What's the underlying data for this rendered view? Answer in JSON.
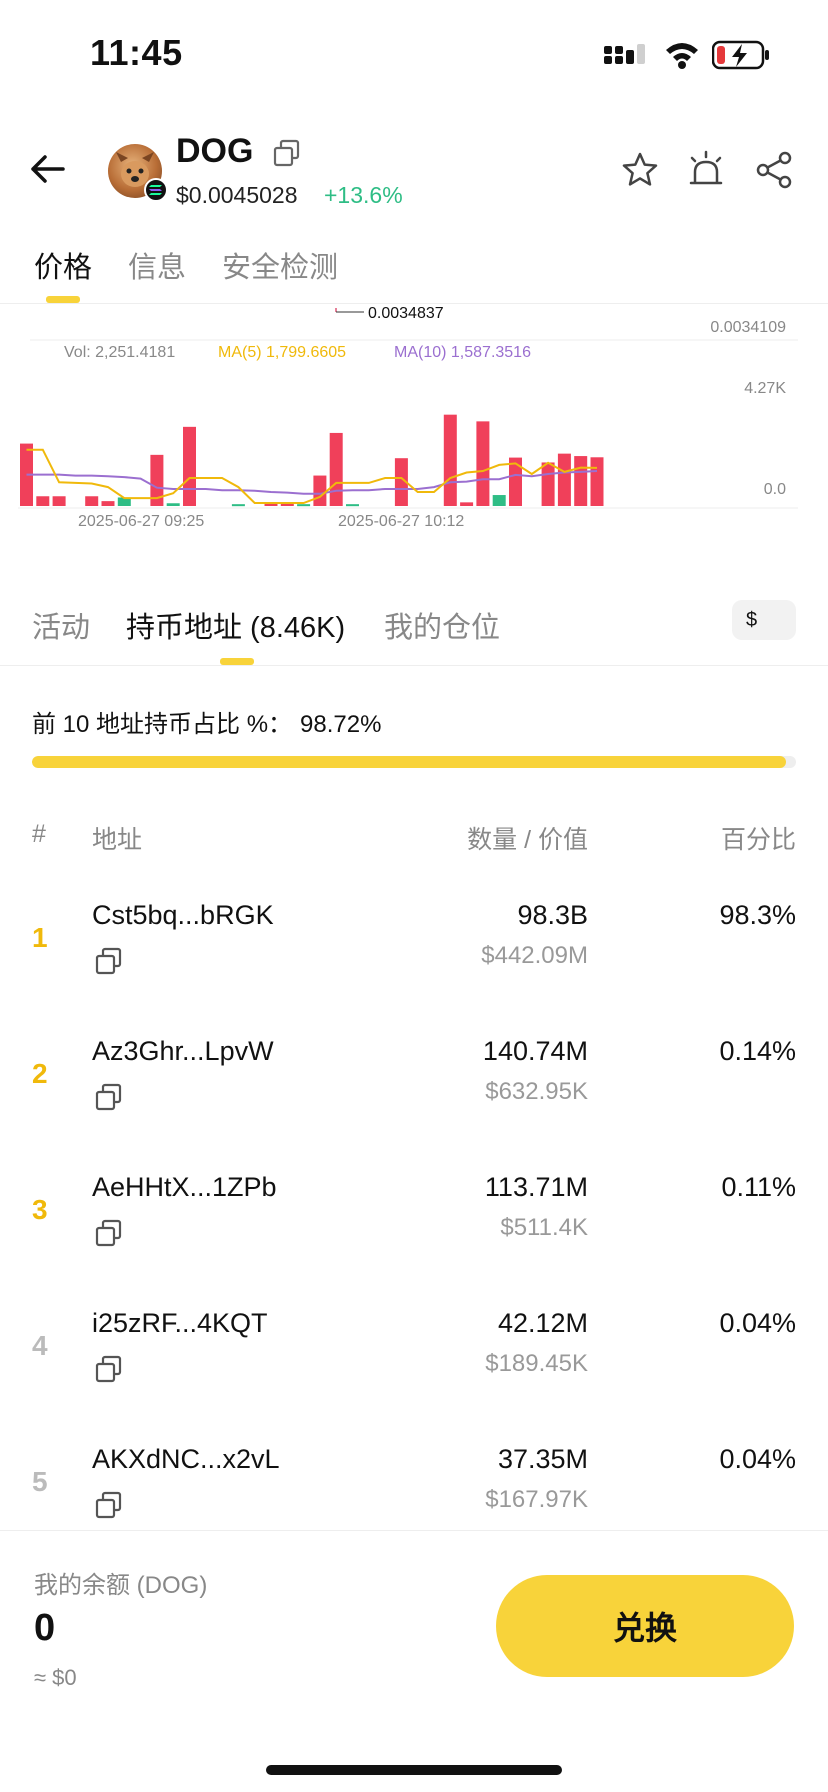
{
  "status_bar": {
    "time": "11:45"
  },
  "header": {
    "token_name": "DOG",
    "price": "$0.0045028",
    "change": "+13.6%",
    "colors": {
      "positive": "#2ebd85",
      "accent": "#f8d33a"
    }
  },
  "top_tabs": [
    {
      "label": "价格",
      "active": true
    },
    {
      "label": "信息",
      "active": false
    },
    {
      "label": "安全检测",
      "active": false
    }
  ],
  "chart_data": {
    "type": "bar",
    "price_marker_label": "0.0034837",
    "right_price_label": "0.0034109",
    "legend": {
      "vol": "Vol: 2,251.4181",
      "ma5": "MA(5) 1,799.6605",
      "ma10": "MA(10) 1,587.3516"
    },
    "y_ticks": [
      "4.27K",
      "0.0"
    ],
    "x_ticks": [
      "2025-06-27 09:25",
      "2025-06-27 10:12"
    ],
    "ylim": [
      0,
      4270
    ],
    "series": [
      {
        "name": "Vol",
        "color_up": "#f0405a",
        "color_down": "#2ebd85",
        "values": [
          2050,
          320,
          320,
          0,
          320,
          160,
          280,
          0,
          1680,
          90,
          2600,
          0,
          0,
          60,
          0,
          70,
          70,
          60,
          1000,
          2400,
          60,
          0,
          0,
          1570,
          0,
          0,
          3000,
          120,
          2780,
          360,
          1590,
          0,
          1430,
          1720,
          1640,
          1600
        ],
        "direction": [
          "up",
          "up",
          "up",
          "up",
          "up",
          "up",
          "down",
          "up",
          "up",
          "down",
          "up",
          "up",
          "up",
          "down",
          "up",
          "up",
          "up",
          "down",
          "up",
          "up",
          "down",
          "up",
          "up",
          "up",
          "up",
          "up",
          "up",
          "up",
          "up",
          "down",
          "up",
          "up",
          "up",
          "up",
          "up",
          "up"
        ]
      },
      {
        "name": "MA(5)",
        "color": "#f0b90b",
        "values": [
          1850,
          1850,
          780,
          760,
          740,
          620,
          260,
          260,
          260,
          420,
          920,
          920,
          920,
          620,
          100,
          100,
          100,
          100,
          300,
          760,
          760,
          760,
          920,
          920,
          460,
          460,
          920,
          1100,
          1150,
          1350,
          1400,
          1050,
          1420,
          1120,
          1260,
          1250
        ]
      },
      {
        "name": "MA(10)",
        "color": "#9b6fd0",
        "values": [
          1030,
          1030,
          1030,
          1000,
          1000,
          980,
          950,
          900,
          600,
          560,
          560,
          560,
          520,
          520,
          500,
          460,
          440,
          400,
          400,
          500,
          520,
          520,
          560,
          560,
          560,
          620,
          780,
          800,
          880,
          880,
          1020,
          980,
          1050,
          1100,
          1120,
          1150
        ]
      }
    ]
  },
  "section_tabs": [
    {
      "label": "活动",
      "active": false
    },
    {
      "label": "持币地址 (8.46K)",
      "active": true
    },
    {
      "label": "我的仓位",
      "active": false
    }
  ],
  "currency_toggle": "$",
  "top10": {
    "label": "前 10 地址持币占比 %：",
    "value": "98.72%",
    "fraction": 0.9872
  },
  "table": {
    "headers": {
      "num": "#",
      "address": "地址",
      "qty_value": "数量 / 价值",
      "percent": "百分比"
    },
    "rows": [
      {
        "rank": "1",
        "address": "Cst5bq...bRGK",
        "qty": "98.3B",
        "value": "$442.09M",
        "percent": "98.3%",
        "rank_color": "#f0b90b"
      },
      {
        "rank": "2",
        "address": "Az3Ghr...LpvW",
        "qty": "140.74M",
        "value": "$632.95K",
        "percent": "0.14%",
        "rank_color": "#f0b90b"
      },
      {
        "rank": "3",
        "address": "AeHHtX...1ZPb",
        "qty": "113.71M",
        "value": "$511.4K",
        "percent": "0.11%",
        "rank_color": "#f0b90b"
      },
      {
        "rank": "4",
        "address": "i25zRF...4KQT",
        "qty": "42.12M",
        "value": "$189.45K",
        "percent": "0.04%",
        "rank_color": "#bbbbbb"
      },
      {
        "rank": "5",
        "address": "AKXdNC...x2vL",
        "qty": "37.35M",
        "value": "$167.97K",
        "percent": "0.04%",
        "rank_color": "#bbbbbb"
      }
    ]
  },
  "bottom": {
    "balance_label": "我的余额 (DOG)",
    "balance_amount": "0",
    "balance_usd": "≈ $0",
    "swap_label": "兑换"
  }
}
